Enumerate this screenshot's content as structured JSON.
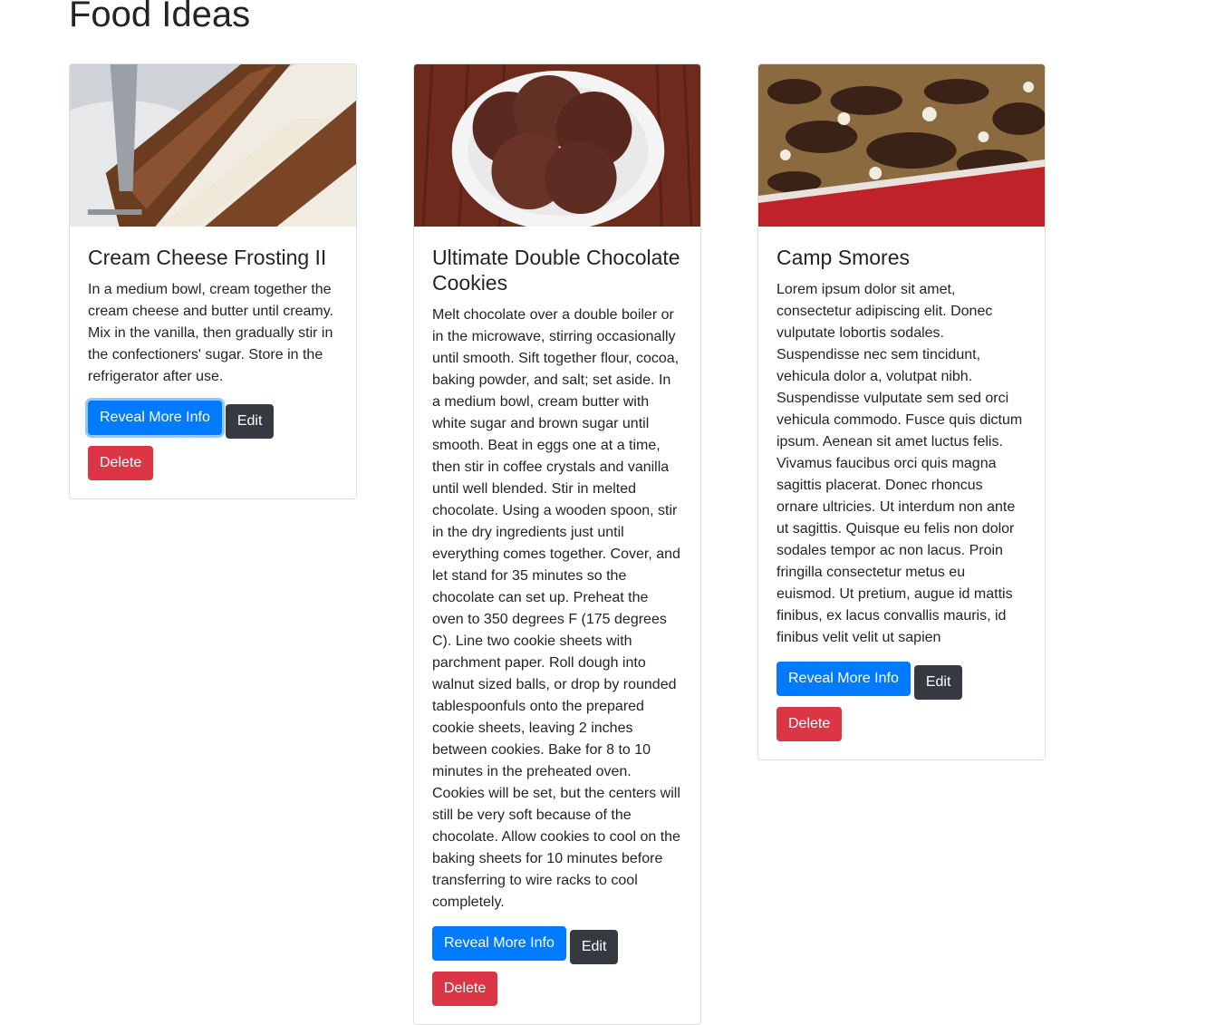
{
  "page": {
    "title": "Food Ideas"
  },
  "colors": {
    "primary": "#007bff",
    "dark": "#343a40",
    "danger": "#dc3545"
  },
  "cards": [
    {
      "image": "carrot-cake-slice-photo",
      "title": "Cream Cheese Frosting II",
      "text": "In a medium bowl, cream together the cream cheese and butter until creamy. Mix in the vanilla, then gradually stir in the confectioners' sugar. Store in the refrigerator after use.",
      "reveal_label": "Reveal More Info",
      "edit_label": "Edit",
      "delete_label": "Delete"
    },
    {
      "image": "chocolate-cookies-plate-photo",
      "title": "Ultimate Double Chocolate Cookies",
      "text": "Melt chocolate over a double boiler or in the microwave, stirring occasionally until smooth. Sift together flour, cocoa, baking powder, and salt; set aside. In a medium bowl, cream butter with white sugar and brown sugar until smooth. Beat in eggs one at a time, then stir in coffee crystals and vanilla until well blended. Stir in melted chocolate. Using a wooden spoon, stir in the dry ingredients just until everything comes together. Cover, and let stand for 35 minutes so the chocolate can set up. Preheat the oven to 350 degrees F (175 degrees C). Line two cookie sheets with parchment paper. Roll dough into walnut sized balls, or drop by rounded tablespoonfuls onto the prepared cookie sheets, leaving 2 inches between cookies. Bake for 8 to 10 minutes in the preheated oven. Cookies will be set, but the centers will still be very soft because of the chocolate. Allow cookies to cool on the baking sheets for 10 minutes before transferring to wire racks to cool completely.",
      "reveal_label": "Reveal More Info",
      "edit_label": "Edit",
      "delete_label": "Delete"
    },
    {
      "image": "smores-bake-photo",
      "title": "Camp Smores",
      "text": "Lorem ipsum dolor sit amet, consectetur adipiscing elit. Donec vulputate lobortis sodales. Suspendisse nec sem tincidunt, vehicula dolor a, volutpat nibh. Suspendisse vulputate sem sed orci vehicula commodo. Fusce quis dictum ipsum. Aenean sit amet luctus felis. Vivamus faucibus orci quis magna sagittis placerat. Donec rhoncus ornare ultricies. Ut interdum non ante ut sagittis. Quisque eu felis non dolor sodales tempor ac non lacus. Proin fringilla consectetur metus eu euismod. Ut pretium, augue id mattis finibus, ex lacus convallis mauris, id finibus velit velit ut sapien",
      "reveal_label": "Reveal More Info",
      "edit_label": "Edit",
      "delete_label": "Delete"
    }
  ]
}
